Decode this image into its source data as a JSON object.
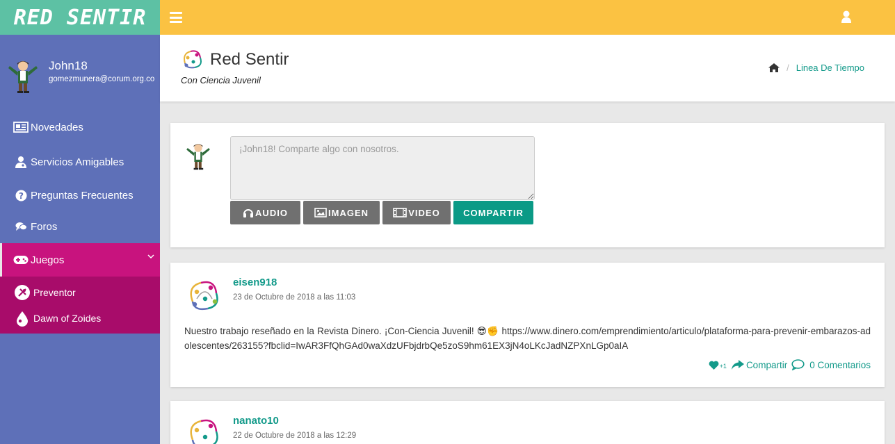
{
  "brand": {
    "name": "RED SENTIR"
  },
  "user": {
    "name": "John18",
    "email": "gomezmunera@corum.org.co"
  },
  "menu": {
    "items": [
      {
        "label": "Novedades"
      },
      {
        "label": "Servicios Amigables"
      },
      {
        "label": "Preguntas Frecuentes"
      },
      {
        "label": "Foros"
      },
      {
        "label": "Juegos"
      }
    ],
    "submenu": [
      {
        "label": "Preventor"
      },
      {
        "label": "Dawn of Zoides"
      }
    ]
  },
  "header": {
    "title": "Red Sentir",
    "subtitle": "Con Ciencia Juvenil",
    "breadcrumb": "Linea De Tiempo"
  },
  "composer": {
    "placeholder": "¡John18! Comparte algo con nosotros.",
    "audio_label": "AUDIO",
    "image_label": "IMAGEN",
    "video_label": "VIDEO",
    "share_label": "COMPARTIR"
  },
  "posts": [
    {
      "author": "eisen918",
      "date": "23 de Octubre de 2018 a las 11:03",
      "text": "Nuestro trabajo reseñado en la Revista Dinero. ¡Con-Ciencia Juvenil! 😎✊ https://www.dinero.com/emprendimiento/articulo/plataforma-para-prevenir-embarazos-adolescentes/263155?fbclid=IwAR3FfQhGAd0waXdzUFbjdrbQe5zoS9hm61EX3jN4oLKcJadNZPXnLGp0aIA",
      "likes": "+1",
      "share_label": "Compartir",
      "comments_label": "0 Comentarios"
    },
    {
      "author": "nanato10",
      "date": "22 de Octubre de 2018 a las 12:29"
    }
  ],
  "colors": {
    "brand_bg": "#5dc1a4",
    "topbar": "#fbc242",
    "sidebar": "#5e70b8",
    "active": "#c8137e",
    "submenu": "#a80c6a",
    "accent": "#139a8a",
    "button_gray": "#707070",
    "button_green": "#0b9a86"
  },
  "icons": {
    "hamburger": "hamburger-icon",
    "user": "user-icon",
    "home": "home-icon",
    "heart": "heart-icon",
    "share": "share-icon",
    "comment": "comment-icon"
  }
}
